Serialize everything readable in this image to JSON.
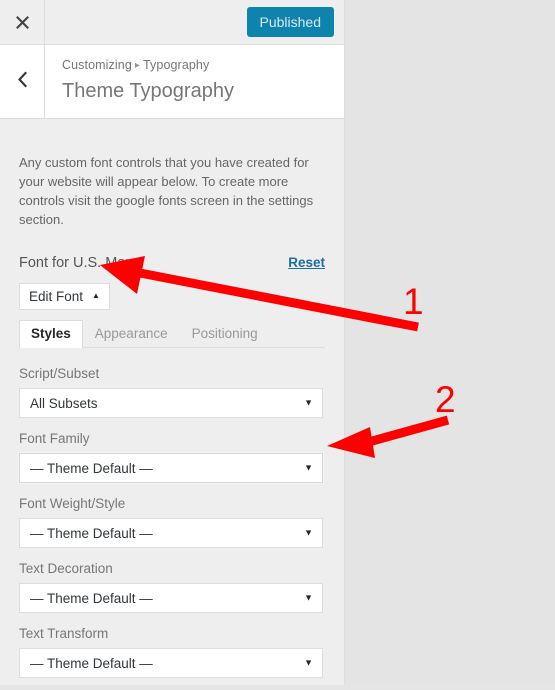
{
  "topbar": {
    "close_icon": "close-x-icon",
    "publish_label": "Published"
  },
  "section_header": {
    "back_icon": "chevron-left-icon",
    "breadcrumb_root": "Customizing",
    "breadcrumb_separator": "▸",
    "breadcrumb_current": "Typography",
    "title": "Theme Typography"
  },
  "body": {
    "description": "Any custom font controls that you have created for your website will appear below. To create more controls visit the google fonts screen in the settings section.",
    "control_title": "Font for U.S. Map",
    "reset_label": "Reset",
    "edit_font_label": "Edit Font",
    "edit_font_caret": "▲"
  },
  "tabs": [
    {
      "label": "Styles",
      "active": true
    },
    {
      "label": "Appearance",
      "active": false
    },
    {
      "label": "Positioning",
      "active": false
    }
  ],
  "fields": [
    {
      "label": "Script/Subset",
      "value": "All Subsets",
      "arrow": "▼",
      "focused": false
    },
    {
      "label": "Font Family",
      "value": "— Theme Default —",
      "arrow": "▼",
      "focused": true
    },
    {
      "label": "Font Weight/Style",
      "value": "— Theme Default —",
      "arrow": "▼",
      "focused": false
    },
    {
      "label": "Text Decoration",
      "value": "— Theme Default —",
      "arrow": "▼",
      "focused": false
    },
    {
      "label": "Text Transform",
      "value": "— Theme Default —",
      "arrow": "▼",
      "focused": false
    }
  ],
  "annotations": [
    {
      "number": "1",
      "target": "edit-font-toggle"
    },
    {
      "number": "2",
      "target": "font-family-select"
    }
  ],
  "colors": {
    "publish_button": "#0e84ad",
    "reset_link": "#1a6ea3",
    "annotation_red": "#fe0000",
    "panel_background": "#eeeeee",
    "preview_background": "#e4e4e4"
  }
}
